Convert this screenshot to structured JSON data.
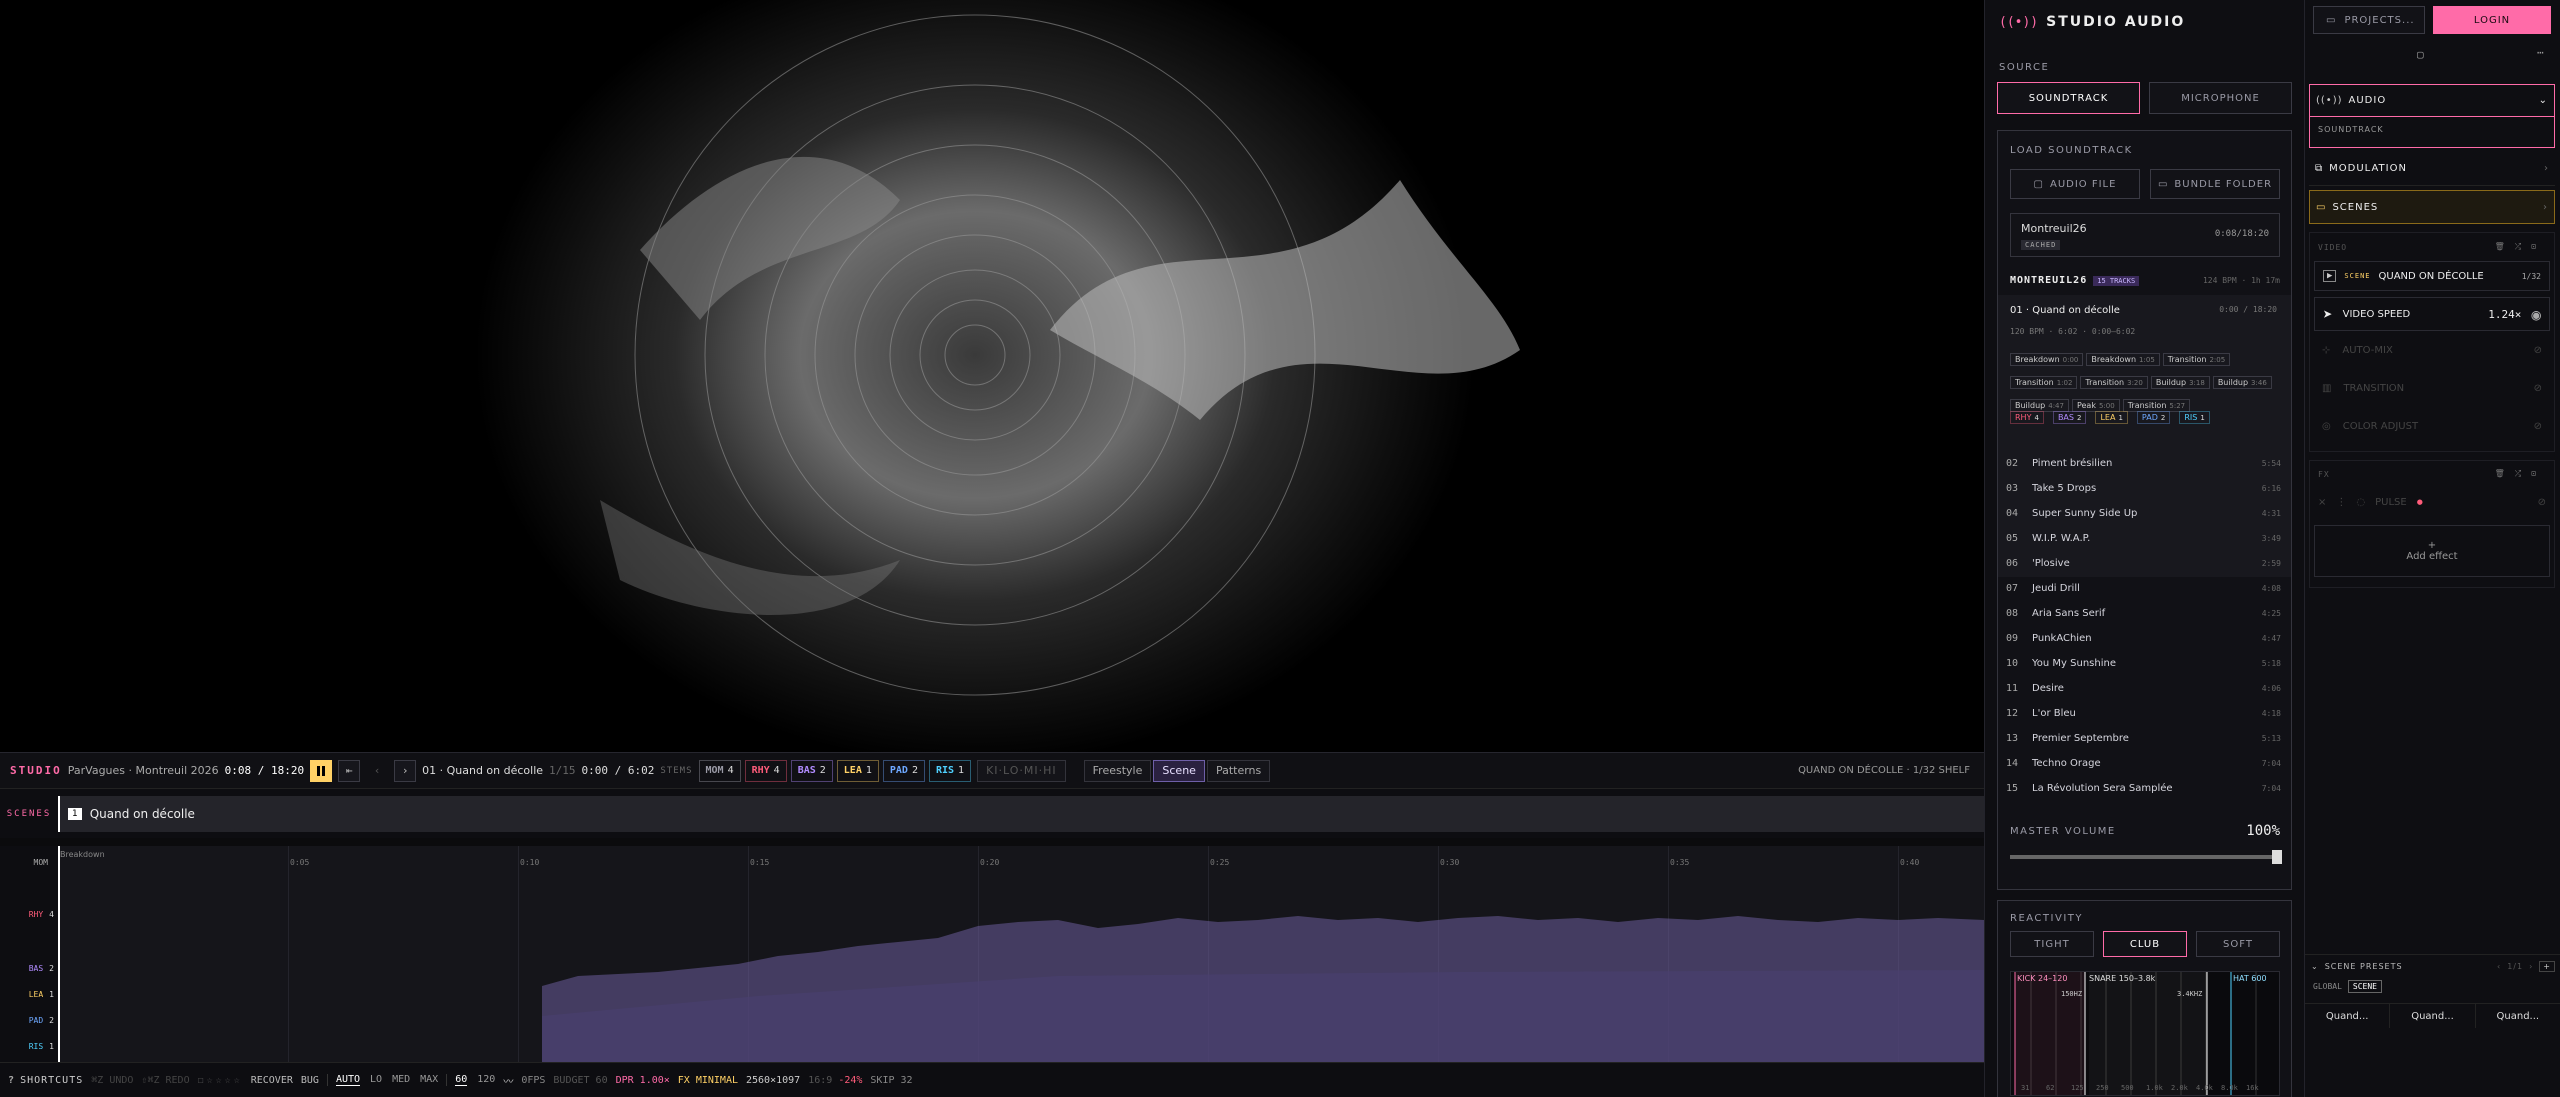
{
  "transport": {
    "brand": "STUDIO",
    "project": "ParVagues · Montreuil 2026",
    "time": "0:08 / 18:20",
    "track": "01 · Quand on décolle",
    "track_pos": "1/15",
    "track_time": "0:00 / 6:02",
    "stems_label": "STEMS",
    "stems": [
      {
        "name": "MOM",
        "count": "4",
        "color": "#9a9aa6"
      },
      {
        "name": "RHY",
        "count": "4",
        "color": "#ff5c7a"
      },
      {
        "name": "BAS",
        "count": "2",
        "color": "#b18cff"
      },
      {
        "name": "LEA",
        "count": "1",
        "color": "#ffd166"
      },
      {
        "name": "PAD",
        "count": "2",
        "color": "#6ea8ff"
      },
      {
        "name": "RIS",
        "count": "1",
        "color": "#4fd1ff"
      }
    ],
    "bands": "KI·LO·MI·HI",
    "modes": [
      "Freestyle",
      "Scene",
      "Patterns"
    ],
    "scene_status": "QUAND ON DÉCOLLE · 1/32 SHELF"
  },
  "scenes_bar": {
    "label": "SCENES",
    "num": "1",
    "name": "Quand on décolle"
  },
  "timeline": {
    "section": "Breakdown",
    "ticks": [
      "0:05",
      "0:10",
      "0:15",
      "0:20",
      "0:25",
      "0:30",
      "0:35",
      "0:40"
    ],
    "lanes": [
      {
        "name": "MOM",
        "count": "",
        "color": "#aaa"
      },
      {
        "name": "RHY",
        "count": "4",
        "color": "#ff5c7a"
      },
      {
        "name": "BAS",
        "count": "2",
        "color": "#b18cff"
      },
      {
        "name": "LEA",
        "count": "1",
        "color": "#ffd166"
      },
      {
        "name": "PAD",
        "count": "2",
        "color": "#6ea8ff"
      },
      {
        "name": "RIS",
        "count": "1",
        "color": "#4fd1ff"
      }
    ]
  },
  "toolbar": {
    "shortcuts": "SHORTCUTS",
    "shortcuts_key": "?",
    "undo": "UNDO",
    "undo_key": "⌘Z",
    "redo": "REDO",
    "redo_key": "⇧⌘Z",
    "recover": "RECOVER",
    "bug": "BUG",
    "quality": [
      "AUTO",
      "LO",
      "MED",
      "MAX"
    ],
    "fps": [
      "60",
      "120"
    ],
    "fps_readout": "0FPS",
    "budget": "BUDGET 60",
    "dpr": "DPR 1.00×",
    "fx": "FX MINIMAL",
    "res": "2560×1097",
    "aspect": "16:9",
    "aspect_delta": "-24%",
    "skip": "SKIP 32"
  },
  "audio_panel": {
    "title": "STUDIO AUDIO",
    "source_label": "SOURCE",
    "sources": [
      "SOUNDTRACK",
      "MICROPHONE"
    ],
    "load_label": "LOAD SOUNDTRACK",
    "load_buttons": [
      "AUDIO FILE",
      "BUNDLE FOLDER"
    ],
    "loaded_name": "Montreuil26",
    "loaded_badge": "CACHED",
    "loaded_time": "0:08/18:20",
    "album": "MONTREUIL26",
    "album_tracks": "15 TRACKS",
    "album_meta": "124 BPM · 1h 17m",
    "current": {
      "title": "01 · Quand on décolle",
      "time": "0:00 / 18:20",
      "meta": "120 BPM · 6:02 · 0:00–6:02",
      "sections": [
        {
          "n": "Breakdown",
          "t": "0:00"
        },
        {
          "n": "Breakdown",
          "t": "1:05"
        },
        {
          "n": "Transition",
          "t": "2:05"
        },
        {
          "n": "Transition",
          "t": "1:02"
        },
        {
          "n": "Transition",
          "t": "3:20"
        },
        {
          "n": "Buildup",
          "t": "3:18"
        },
        {
          "n": "Buildup",
          "t": "3:46"
        },
        {
          "n": "Buildup",
          "t": "4:47"
        },
        {
          "n": "Peak",
          "t": "5:00"
        },
        {
          "n": "Transition",
          "t": "5:27"
        }
      ],
      "stems": [
        {
          "n": "RHY",
          "c": "4",
          "color": "#ff5c7a"
        },
        {
          "n": "BAS",
          "c": "2",
          "color": "#b18cff"
        },
        {
          "n": "LEA",
          "c": "1",
          "color": "#ffd166"
        },
        {
          "n": "PAD",
          "c": "2",
          "color": "#6ea8ff"
        },
        {
          "n": "RIS",
          "c": "1",
          "color": "#4fd1ff"
        }
      ]
    },
    "tracks": [
      {
        "no": "02",
        "name": "Piment brésilien",
        "dur": "5:54"
      },
      {
        "no": "03",
        "name": "Take 5 Drops",
        "dur": "6:16"
      },
      {
        "no": "04",
        "name": "Super Sunny Side Up",
        "dur": "4:31"
      },
      {
        "no": "05",
        "name": "W.I.P. W.A.P.",
        "dur": "3:49"
      },
      {
        "no": "06",
        "name": "'Plosive",
        "dur": "2:59"
      },
      {
        "no": "07",
        "name": "Jeudi Drill",
        "dur": "4:08"
      },
      {
        "no": "08",
        "name": "Aria Sans Serif",
        "dur": "4:25"
      },
      {
        "no": "09",
        "name": "PunkAChien",
        "dur": "4:47"
      },
      {
        "no": "10",
        "name": "You My Sunshine",
        "dur": "5:18"
      },
      {
        "no": "11",
        "name": "Desire",
        "dur": "4:06"
      },
      {
        "no": "12",
        "name": "L'or Bleu",
        "dur": "4:18"
      },
      {
        "no": "13",
        "name": "Premier Septembre",
        "dur": "5:13"
      },
      {
        "no": "14",
        "name": "Techno Orage",
        "dur": "7:04"
      },
      {
        "no": "15",
        "name": "La Révolution Sera Samplée",
        "dur": "7:04"
      }
    ],
    "master_label": "MASTER VOLUME",
    "master_value": "100%",
    "master_level": 1.0,
    "reactivity_label": "REACTIVITY",
    "reactivity": [
      "TIGHT",
      "CLUB",
      "SOFT"
    ],
    "spectrum": {
      "bands": [
        "KICK 24–120",
        "SNARE 150–3.8k",
        "HAT 600"
      ],
      "markers": [
        "150HZ",
        "3.4KHZ"
      ],
      "axis": [
        "31",
        "62",
        "125",
        "250",
        "500",
        "1.0k",
        "2.0k",
        "4.0k",
        "8.0k",
        "16k"
      ]
    }
  },
  "side_panel": {
    "projects": "PROJECTS...",
    "login": "LOGIN",
    "audio": "AUDIO",
    "audio_sub": "SOUNDTRACK",
    "modulation": "MODULATION",
    "scenes": "SCENES",
    "video_label": "VIDEO",
    "scene_badge": "SCENE",
    "scene_name": "QUAND ON DÉCOLLE",
    "scene_pos": "1/32",
    "video_speed": "VIDEO SPEED",
    "video_speed_value": "1.24×",
    "auto_mix": "AUTO-MIX",
    "transition": "TRANSITION",
    "color_adjust": "COLOR ADJUST",
    "fx_label": "FX",
    "pulse": "PULSE",
    "add_effect": "Add effect",
    "presets_label": "SCENE PRESETS",
    "presets_pos": "1/1",
    "preset_tabs": [
      "GLOBAL",
      "SCENE"
    ],
    "presets": [
      "Quand...",
      "Quand...",
      "Quand..."
    ]
  },
  "colors": {
    "accent": "#ff6ba8",
    "purple": "#8b7bc8"
  }
}
